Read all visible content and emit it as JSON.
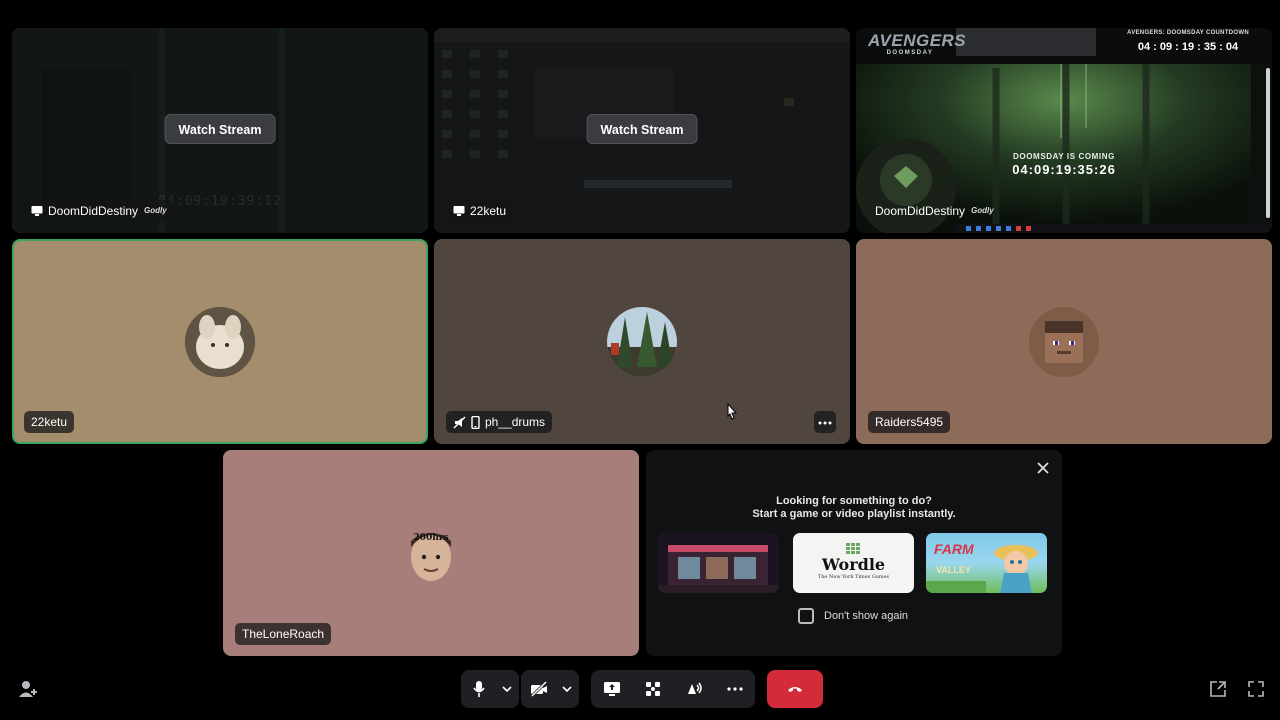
{
  "tiles": {
    "t1": {
      "name": "DoomDidDestiny",
      "badge": "Godly",
      "watch_label": "Watch Stream",
      "ghost_timer": "04:09:19:39:12"
    },
    "t2": {
      "name": "22ketu",
      "watch_label": "Watch Stream"
    },
    "t3": {
      "name": "DoomDidDestiny",
      "badge": "Godly",
      "logo_text": "AVENGERS",
      "logo_sub": "DOOMSDAY",
      "countdown_title": "AVENGERS: DOOMSDAY COUNTDOWN",
      "countdown_value": "04 : 09 : 19 : 35 : 04",
      "center_heading": "DOOMSDAY IS COMING",
      "center_timer": "04:09:19:35:26"
    },
    "t4": {
      "name": "22ketu"
    },
    "t5": {
      "name": "ph__drums"
    },
    "t6": {
      "name": "Raiders5495"
    },
    "t7": {
      "name": "TheLoneRoach",
      "avatar_text": "200hrs"
    }
  },
  "activity": {
    "line1": "Looking for something to do?",
    "line2": "Start a game or video playlist instantly.",
    "dont_show": "Don't show again",
    "games": [
      {
        "name": "store-game"
      },
      {
        "name": "Wordle",
        "label": "Wordle",
        "sub": "The New York Times Games"
      },
      {
        "name": "Farm Merge Valley",
        "label": "FARM",
        "sub": "VALLEY"
      }
    ]
  },
  "colors": {
    "speaking_border": "#3ba55c",
    "end_call": "#d42b3a",
    "tile_tan": "#a38d6d",
    "tile_brown": "#514540",
    "tile_rust": "#8c6b59",
    "tile_rose": "#a87e7a"
  }
}
